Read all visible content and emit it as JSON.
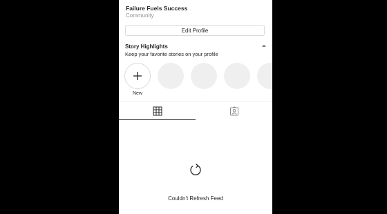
{
  "profile": {
    "name": "Failure Fuels Success",
    "category": "Community",
    "edit_button": "Edit Profile"
  },
  "highlights": {
    "title": "Story Highlights",
    "subtitle": "Keep your favorite stories on your profile",
    "new_label": "New",
    "chevron_icon": "chevron-up-icon",
    "new_icon": "plus-icon"
  },
  "tabs": [
    {
      "icon": "grid-icon",
      "active": true
    },
    {
      "icon": "tagged-user-icon",
      "active": false
    }
  ],
  "feed": {
    "status_icon": "refresh-icon",
    "status_text": "Couldn't Refresh Feed"
  },
  "colors": {
    "background": "#000000",
    "surface": "#ffffff",
    "text": "#262626",
    "muted": "#8e8e8e",
    "border": "#dbdbdb",
    "placeholder": "#efefef"
  }
}
